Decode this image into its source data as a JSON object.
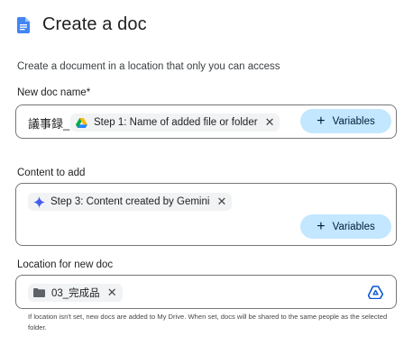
{
  "header": {
    "title": "Create a doc",
    "icon": "google-docs-icon",
    "icon_color": "#4285f4"
  },
  "subtitle": "Create a document in a location that only you can access",
  "doc_name": {
    "label": "New doc name*",
    "prefix_text": "議事録_",
    "chip": {
      "label": "Step 1: Name of added file or folder",
      "icon": "google-drive-icon"
    },
    "variables_button": "Variables"
  },
  "content": {
    "label": "Content to add",
    "chip": {
      "label": "Step 3: Content created by Gemini",
      "icon": "gemini-sparkle-icon"
    },
    "variables_button": "Variables"
  },
  "location": {
    "label": "Location for new doc",
    "chip": {
      "label": "03_完成品",
      "icon": "folder-icon"
    },
    "picker_icon": "google-drive-icon",
    "helper": "If location isn't set, new docs are added to My Drive. When set, docs will be shared to the same people as the selected folder."
  },
  "colors": {
    "accent_button": "#c2e7ff",
    "chip_bg": "#f1f3f4",
    "border": "#747775"
  }
}
